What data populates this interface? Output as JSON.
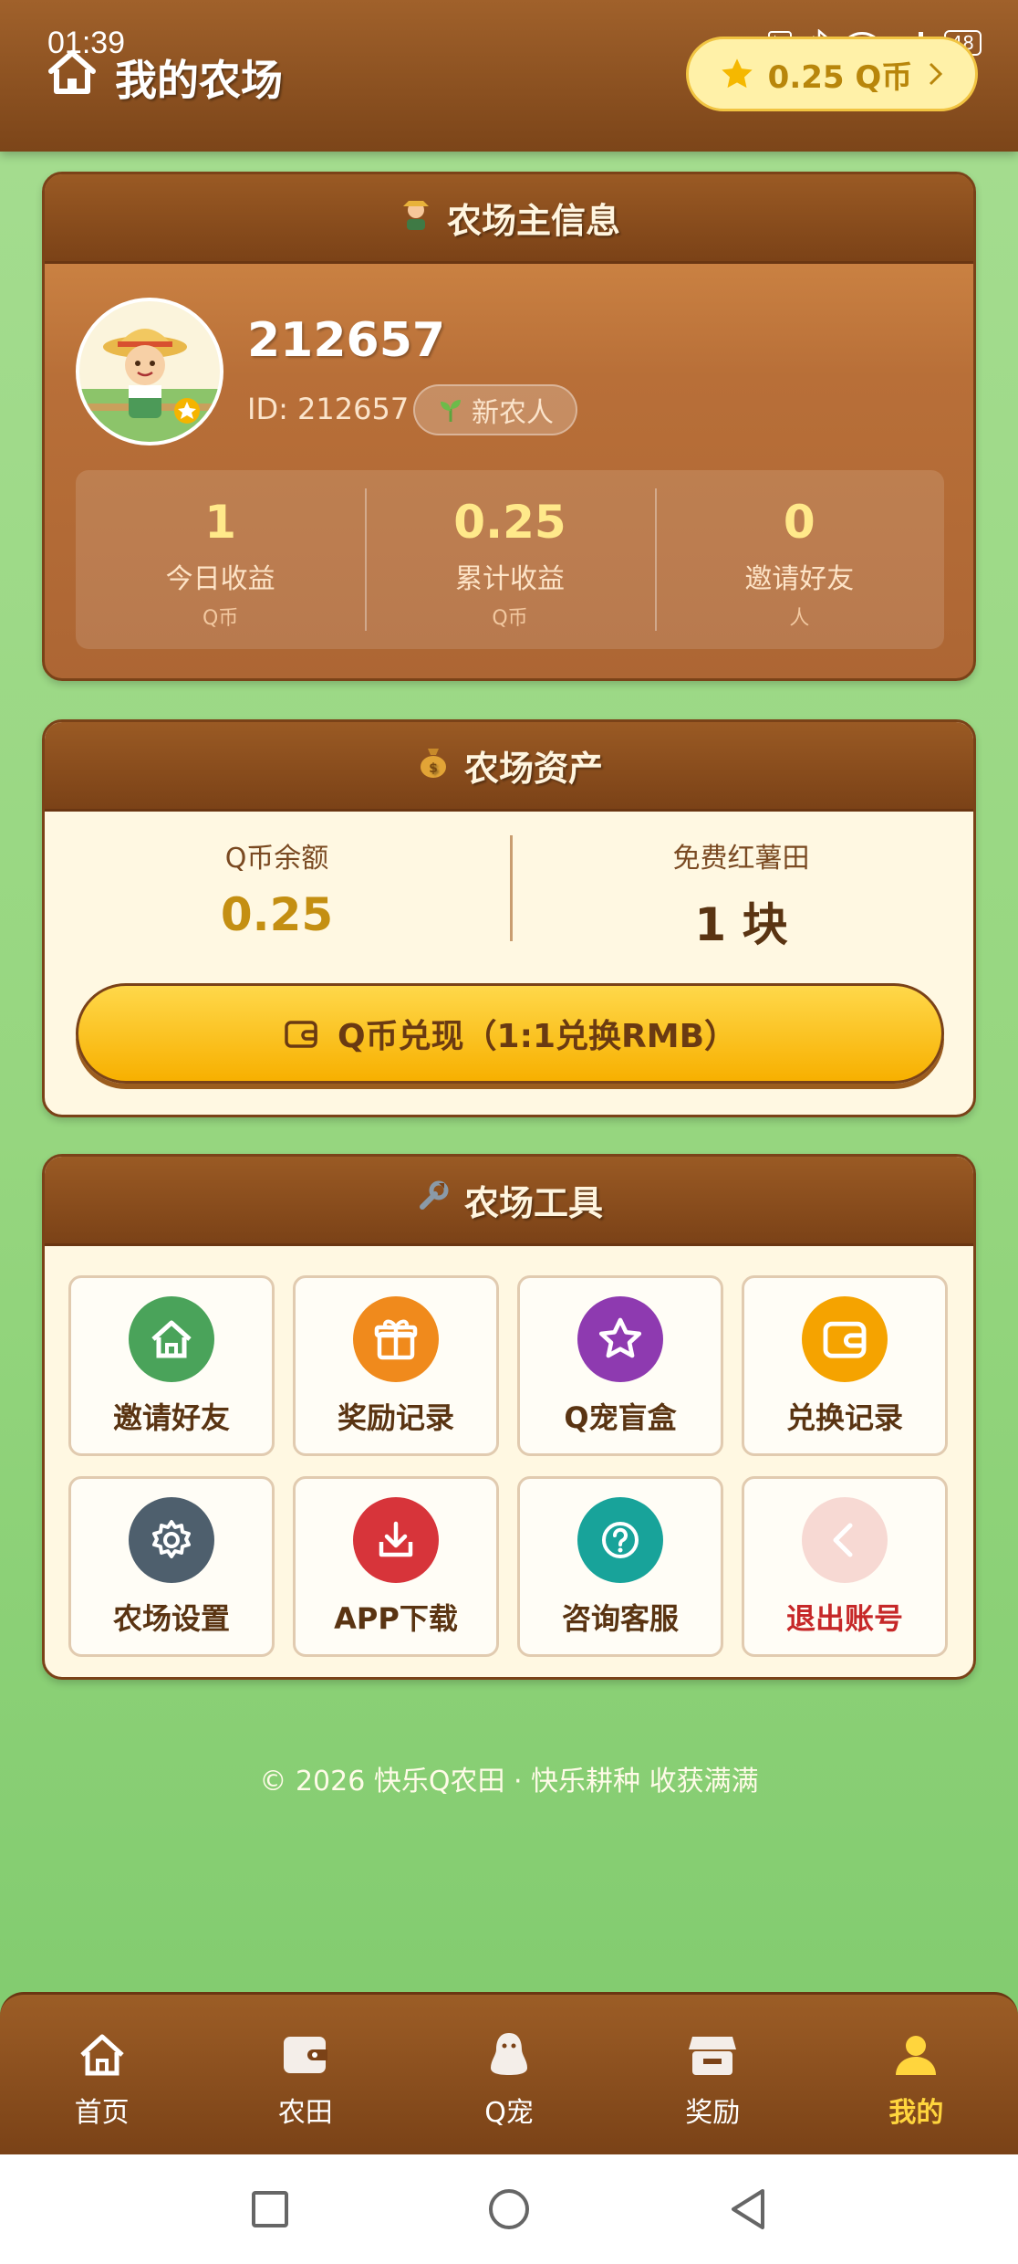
{
  "status_bar": {
    "time": "01:39",
    "battery": "48"
  },
  "header": {
    "title": "我的农场",
    "coin_balance": "0.25 Q币"
  },
  "owner_card": {
    "title": "农场主信息",
    "username": "212657",
    "user_id": "ID: 212657",
    "badge": "新农人",
    "stats": [
      {
        "value": "1",
        "label": "今日收益",
        "unit": "Q币"
      },
      {
        "value": "0.25",
        "label": "累计收益",
        "unit": "Q币"
      },
      {
        "value": "0",
        "label": "邀请好友",
        "unit": "人"
      }
    ]
  },
  "assets_card": {
    "title": "农场资产",
    "q_balance_label": "Q币余额",
    "q_balance_value": "0.25",
    "field_label": "免费红薯田",
    "field_value": "1 块",
    "withdraw_label": "Q币兑现（1:1兑换RMB）",
    "colors": {
      "q_value": "#c48f12",
      "field_value": "#5a3412"
    }
  },
  "tools_card": {
    "title": "农场工具",
    "items": [
      {
        "label": "邀请好友",
        "icon": "home-icon",
        "color": "#4aa35a"
      },
      {
        "label": "奖励记录",
        "icon": "gift-icon",
        "color": "#f08a1c"
      },
      {
        "label": "Q宠盲盒",
        "icon": "star-icon",
        "color": "#8e3ab0"
      },
      {
        "label": "兑换记录",
        "icon": "wallet-icon",
        "color": "#f5a300"
      },
      {
        "label": "农场设置",
        "icon": "gear-icon",
        "color": "#4e5f6d"
      },
      {
        "label": "APP下载",
        "icon": "download-icon",
        "color": "#d7343a"
      },
      {
        "label": "咨询客服",
        "icon": "question-icon",
        "color": "#18a39a"
      },
      {
        "label": "退出账号",
        "icon": "back-arrow-icon",
        "color": "#f7d9d3"
      }
    ]
  },
  "footer": {
    "text": "© 2026 快乐Q农田 · 快乐耕种 收获满满"
  },
  "bottom_nav": {
    "items": [
      {
        "label": "首页",
        "icon": "home-icon"
      },
      {
        "label": "农田",
        "icon": "wallet-icon"
      },
      {
        "label": "Q宠",
        "icon": "penguin-icon"
      },
      {
        "label": "奖励",
        "icon": "store-icon"
      },
      {
        "label": "我的",
        "icon": "user-icon",
        "active": true
      }
    ]
  }
}
